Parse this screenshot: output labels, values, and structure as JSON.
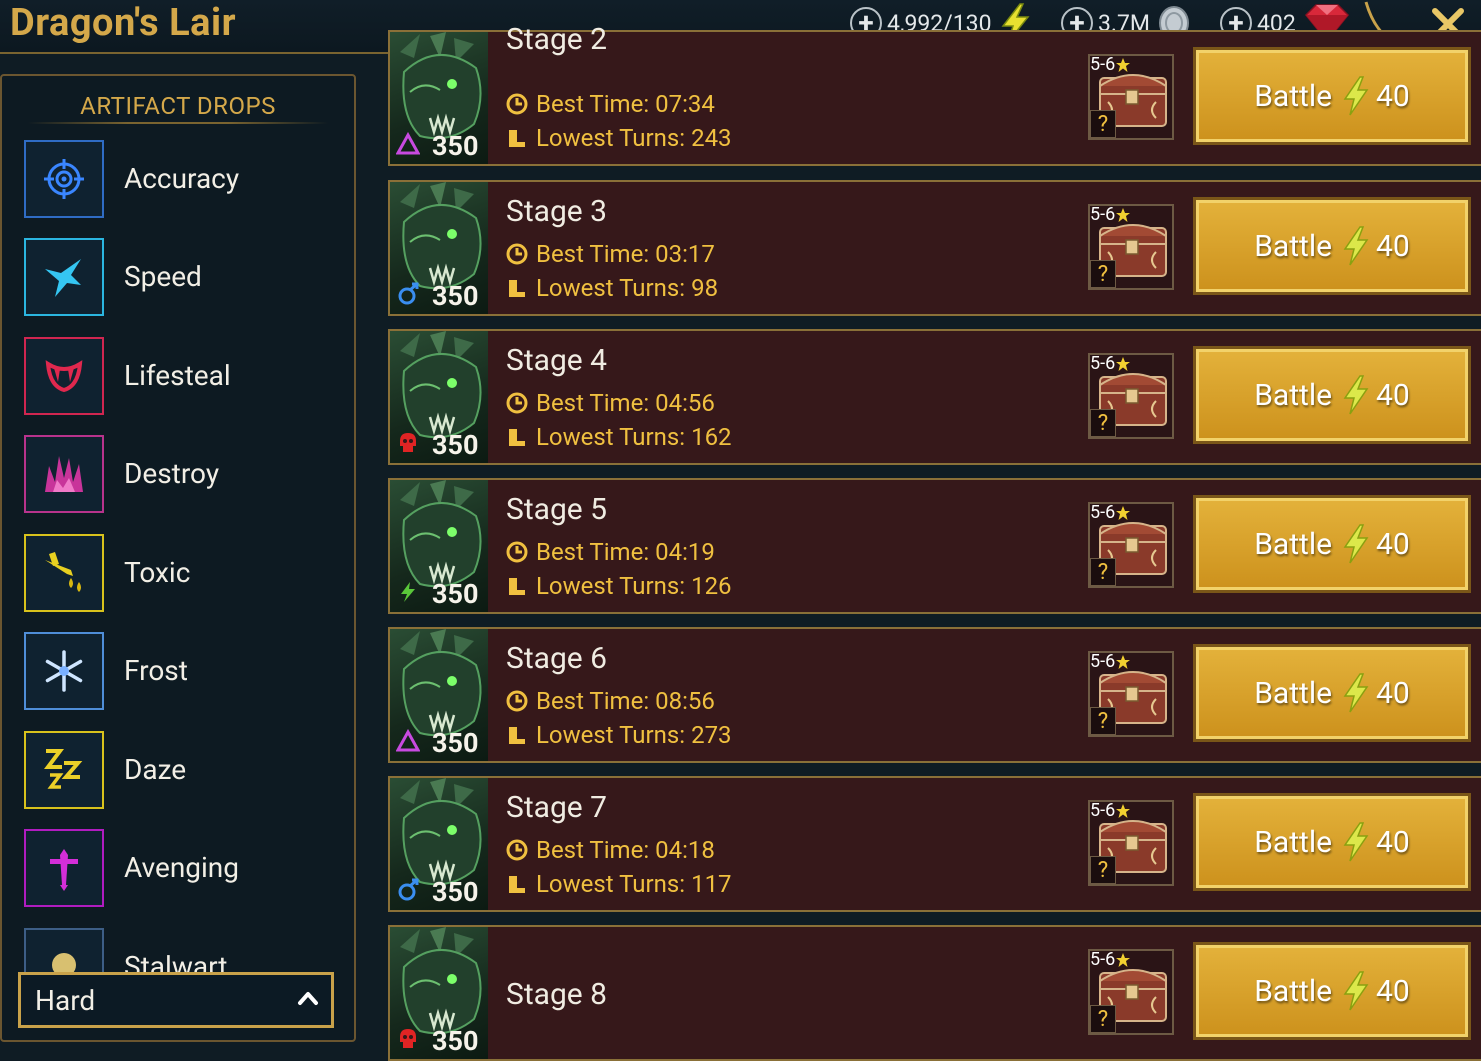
{
  "header": {
    "title": "Dragon's Lair",
    "resources": [
      {
        "name": "energy",
        "value": "4,992/130",
        "icon": "lightning-icon"
      },
      {
        "name": "silver",
        "value": "3.7M",
        "icon": "silver-coin-icon"
      },
      {
        "name": "gems",
        "value": "402",
        "icon": "ruby-gem-icon"
      }
    ],
    "close_icon": "close-icon"
  },
  "artifact_drops": {
    "title": "ARTIFACT DROPS",
    "items": [
      {
        "label": "Accuracy",
        "icon": "crosshair-icon",
        "color": "#2f6cc4"
      },
      {
        "label": "Speed",
        "icon": "speed-bird-icon",
        "color": "#2bb6e0"
      },
      {
        "label": "Lifesteal",
        "icon": "fangs-icon",
        "color": "#d02650"
      },
      {
        "label": "Destroy",
        "icon": "burst-icon",
        "color": "#b8338c"
      },
      {
        "label": "Toxic",
        "icon": "poison-dagger-icon",
        "color": "#d8c21c"
      },
      {
        "label": "Frost",
        "icon": "snowflake-icon",
        "color": "#4f8ed8"
      },
      {
        "label": "Daze",
        "icon": "zzz-icon",
        "color": "#d8c21c"
      },
      {
        "label": "Avenging",
        "icon": "sword-icon",
        "color": "#b01cc0"
      },
      {
        "label": "Stalwart",
        "icon": "shield-icon",
        "color": "#3d5e86"
      }
    ]
  },
  "difficulty": {
    "selected": "Hard"
  },
  "stages": [
    {
      "name": "Stage 2",
      "power": "350",
      "affinity": "magic",
      "best_time": "Best Time: 07:34",
      "lowest_turns": "Lowest Turns: 243",
      "rank": "5-6",
      "cost": "40",
      "button": "Battle"
    },
    {
      "name": "Stage 3",
      "power": "350",
      "affinity": "spirit",
      "best_time": "Best Time: 03:17",
      "lowest_turns": "Lowest Turns: 98",
      "rank": "5-6",
      "cost": "40",
      "button": "Battle"
    },
    {
      "name": "Stage 4",
      "power": "350",
      "affinity": "force",
      "best_time": "Best Time: 04:56",
      "lowest_turns": "Lowest Turns: 162",
      "rank": "5-6",
      "cost": "40",
      "button": "Battle"
    },
    {
      "name": "Stage 5",
      "power": "350",
      "affinity": "void",
      "best_time": "Best Time: 04:19",
      "lowest_turns": "Lowest Turns: 126",
      "rank": "5-6",
      "cost": "40",
      "button": "Battle"
    },
    {
      "name": "Stage 6",
      "power": "350",
      "affinity": "magic",
      "best_time": "Best Time: 08:56",
      "lowest_turns": "Lowest Turns: 273",
      "rank": "5-6",
      "cost": "40",
      "button": "Battle"
    },
    {
      "name": "Stage 7",
      "power": "350",
      "affinity": "spirit",
      "best_time": "Best Time: 04:18",
      "lowest_turns": "Lowest Turns: 117",
      "rank": "5-6",
      "cost": "40",
      "button": "Battle"
    },
    {
      "name": "Stage 8",
      "power": "350",
      "affinity": "force",
      "best_time": "",
      "lowest_turns": "",
      "rank": "5-6",
      "cost": "40",
      "button": "Battle"
    }
  ]
}
